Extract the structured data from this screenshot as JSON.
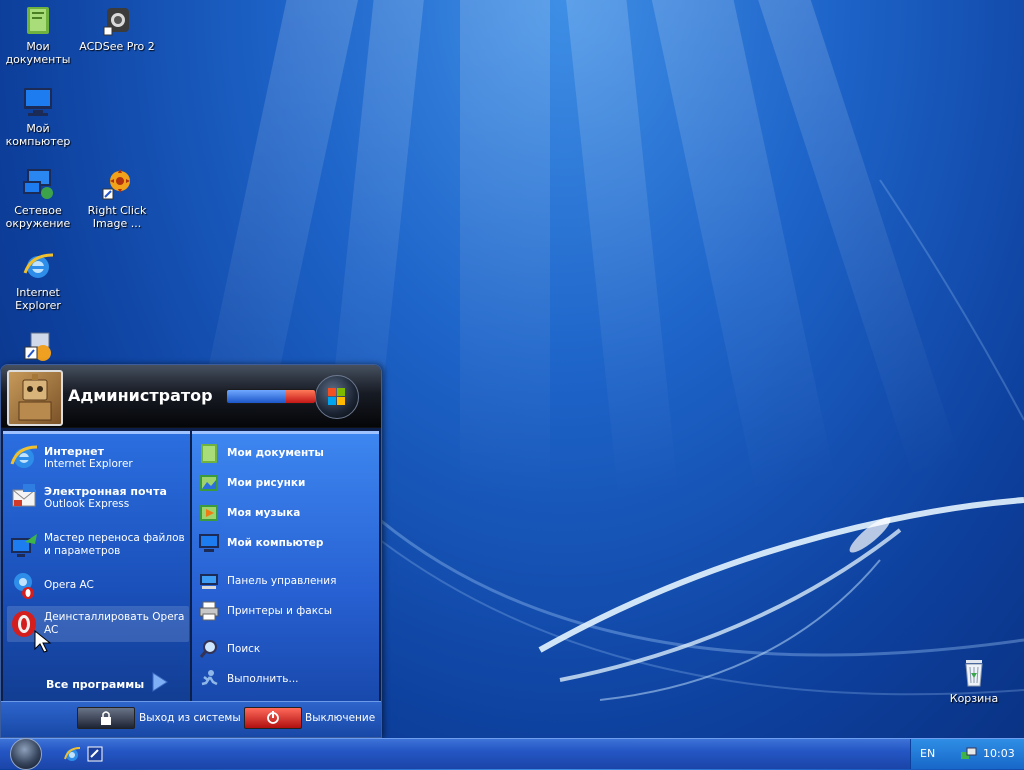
{
  "desktop": {
    "icons": [
      {
        "label": "Мои документы",
        "icon": "my-documents-icon"
      },
      {
        "label": "ACDSee Pro 2",
        "icon": "acdsee-icon"
      },
      {
        "label": "Мой компьютер",
        "icon": "my-computer-icon"
      },
      {
        "label": "Сетевое окружение",
        "icon": "network-places-icon"
      },
      {
        "label": "Right Click Image ...",
        "icon": "right-click-image-icon"
      },
      {
        "label": "Internet Explorer",
        "icon": "internet-explorer-icon"
      },
      {
        "label": "",
        "icon": "shortcut-icon"
      },
      {
        "label": "Корзина",
        "icon": "recycle-bin-icon"
      }
    ]
  },
  "start_menu": {
    "user_name": "Администратор",
    "left_items": [
      {
        "title": "Интернет",
        "subtitle": "Internet Explorer",
        "icon": "internet-explorer-icon"
      },
      {
        "title": "Электронная почта",
        "subtitle": "Outlook Express",
        "icon": "outlook-express-icon"
      },
      {
        "title": "Мастер переноса файлов и параметров",
        "icon": "transfer-wizard-icon"
      },
      {
        "title": "Opera AC",
        "icon": "opera-icon"
      },
      {
        "title": "Деинсталлировать Opera AC",
        "icon": "opera-uninstall-icon"
      }
    ],
    "all_programs": "Все программы",
    "right_items": [
      {
        "label": "Мои документы",
        "icon": "my-documents-icon"
      },
      {
        "label": "Мои рисунки",
        "icon": "my-pictures-icon"
      },
      {
        "label": "Моя музыка",
        "icon": "my-music-icon"
      },
      {
        "label": "Мой компьютер",
        "icon": "my-computer-icon"
      },
      {
        "label": "Панель управления",
        "icon": "control-panel-icon"
      },
      {
        "label": "Принтеры и факсы",
        "icon": "printers-icon"
      },
      {
        "label": "Поиск",
        "icon": "search-icon"
      },
      {
        "label": "Выполнить...",
        "icon": "run-icon"
      }
    ],
    "logoff_label": "Выход из системы",
    "shutdown_label": "Выключение"
  },
  "taskbar": {
    "language": "EN",
    "clock": "10:03"
  },
  "colors": {
    "accent": "#2760d2",
    "header_dark": "#171b24",
    "logoff_red": "#c41616"
  }
}
